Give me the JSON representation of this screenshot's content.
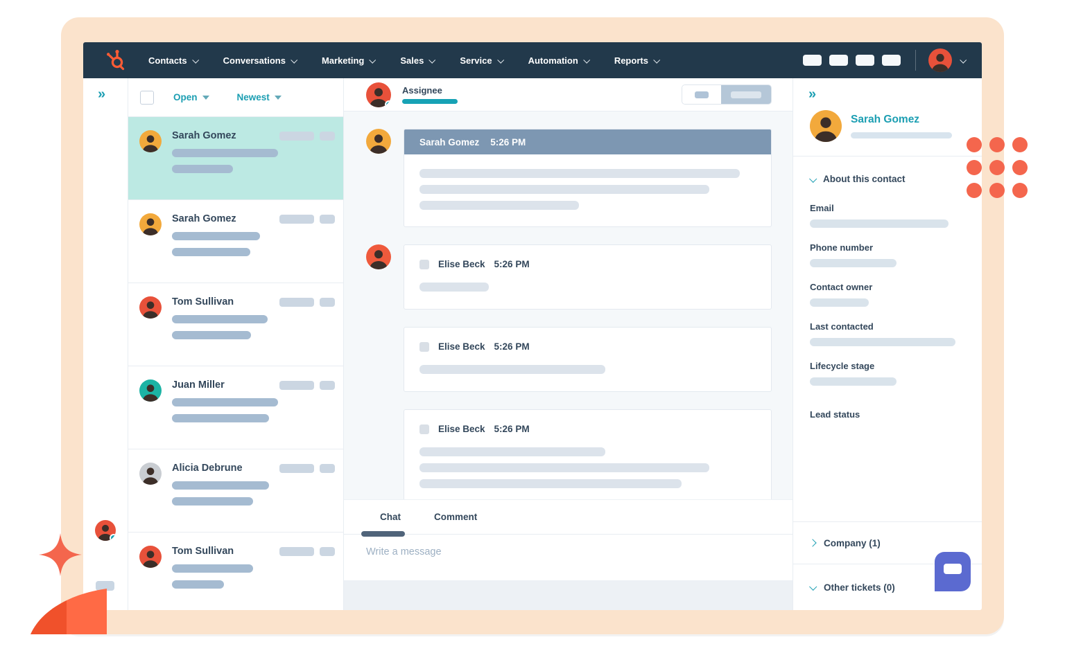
{
  "colors": {
    "accent_orange": "#FF5C35",
    "deco_orange": "#F4664D",
    "teal": "#1B9EB2",
    "navy_text": "#33475B",
    "nav_bg": "#22394B",
    "selected_row": "#BCE9E3",
    "message_header": "#7D97B2",
    "widget_purple": "#5B6AD0"
  },
  "nav": {
    "items": [
      {
        "label": "Contacts"
      },
      {
        "label": "Conversations"
      },
      {
        "label": "Marketing"
      },
      {
        "label": "Sales"
      },
      {
        "label": "Service"
      },
      {
        "label": "Automation"
      },
      {
        "label": "Reports"
      }
    ],
    "action_placeholders": 4,
    "user_avatar_color": "#E8513A"
  },
  "inbox": {
    "filter_label": "Open",
    "sort_label": "Newest",
    "conversations": [
      {
        "name": "Sarah Gomez",
        "avatar_color": "#F2A93C",
        "selected": true,
        "bars": [
          153,
          88
        ]
      },
      {
        "name": "Sarah Gomez",
        "avatar_color": "#F2A93C",
        "selected": false,
        "bars": [
          127,
          113
        ]
      },
      {
        "name": "Tom Sullivan",
        "avatar_color": "#E8513A",
        "selected": false,
        "bars": [
          138,
          114
        ]
      },
      {
        "name": "Juan Miller",
        "avatar_color": "#1CB3A4",
        "selected": false,
        "bars": [
          153,
          140
        ]
      },
      {
        "name": "Alicia Debrune",
        "avatar_color": "#C9CDD2",
        "selected": false,
        "bars": [
          140,
          117
        ]
      },
      {
        "name": "Tom Sullivan",
        "avatar_color": "#E8513A",
        "selected": false,
        "bars": [
          117,
          75
        ]
      }
    ]
  },
  "thread": {
    "assignee_label": "Assignee",
    "assignee_avatar_color": "#E8513A",
    "messages": [
      {
        "sender": "Sarah Gomez",
        "time": "5:26 PM",
        "variant": "header",
        "show_avatar": true,
        "avatar_color": "#F2A93C",
        "bars": [
          462,
          418,
          230
        ]
      },
      {
        "sender": "Elise Beck",
        "time": "5:26 PM",
        "variant": "plain",
        "show_avatar": true,
        "avatar_color": "#EF5A3C",
        "bars": [
          100
        ]
      },
      {
        "sender": "Elise Beck",
        "time": "5:26 PM",
        "variant": "plain",
        "show_avatar": false,
        "avatar_color": "#EF5A3C",
        "bars": [
          268
        ]
      },
      {
        "sender": "Elise Beck",
        "time": "5:26 PM",
        "variant": "plain",
        "show_avatar": false,
        "avatar_color": "#EF5A3C",
        "bars": [
          268,
          418,
          378
        ]
      }
    ],
    "composer": {
      "tabs": [
        {
          "label": "Chat",
          "active": true
        },
        {
          "label": "Comment",
          "active": false
        }
      ],
      "placeholder": "Write a message"
    }
  },
  "contact_panel": {
    "name": "Sarah Gomez",
    "avatar_color": "#F2A93C",
    "about_label": "About this contact",
    "fields": [
      {
        "label": "Email",
        "bar": 200,
        "gap_before": false
      },
      {
        "label": "Phone number",
        "bar": 125,
        "gap_before": false
      },
      {
        "label": "Contact owner",
        "bar": 85,
        "gap_before": false
      },
      {
        "label": "Last contacted",
        "bar": 210,
        "gap_before": false
      },
      {
        "label": "Lifecycle stage",
        "bar": 125,
        "gap_before": false
      },
      {
        "label": "Lead status",
        "bar": 0,
        "gap_before": true
      }
    ],
    "sections": [
      {
        "label": "Company (1)",
        "chevron": "right"
      },
      {
        "label": "Other tickets (0)",
        "chevron": "down"
      }
    ]
  },
  "sidebar_strip": {
    "user_avatar_color": "#E8513A"
  }
}
